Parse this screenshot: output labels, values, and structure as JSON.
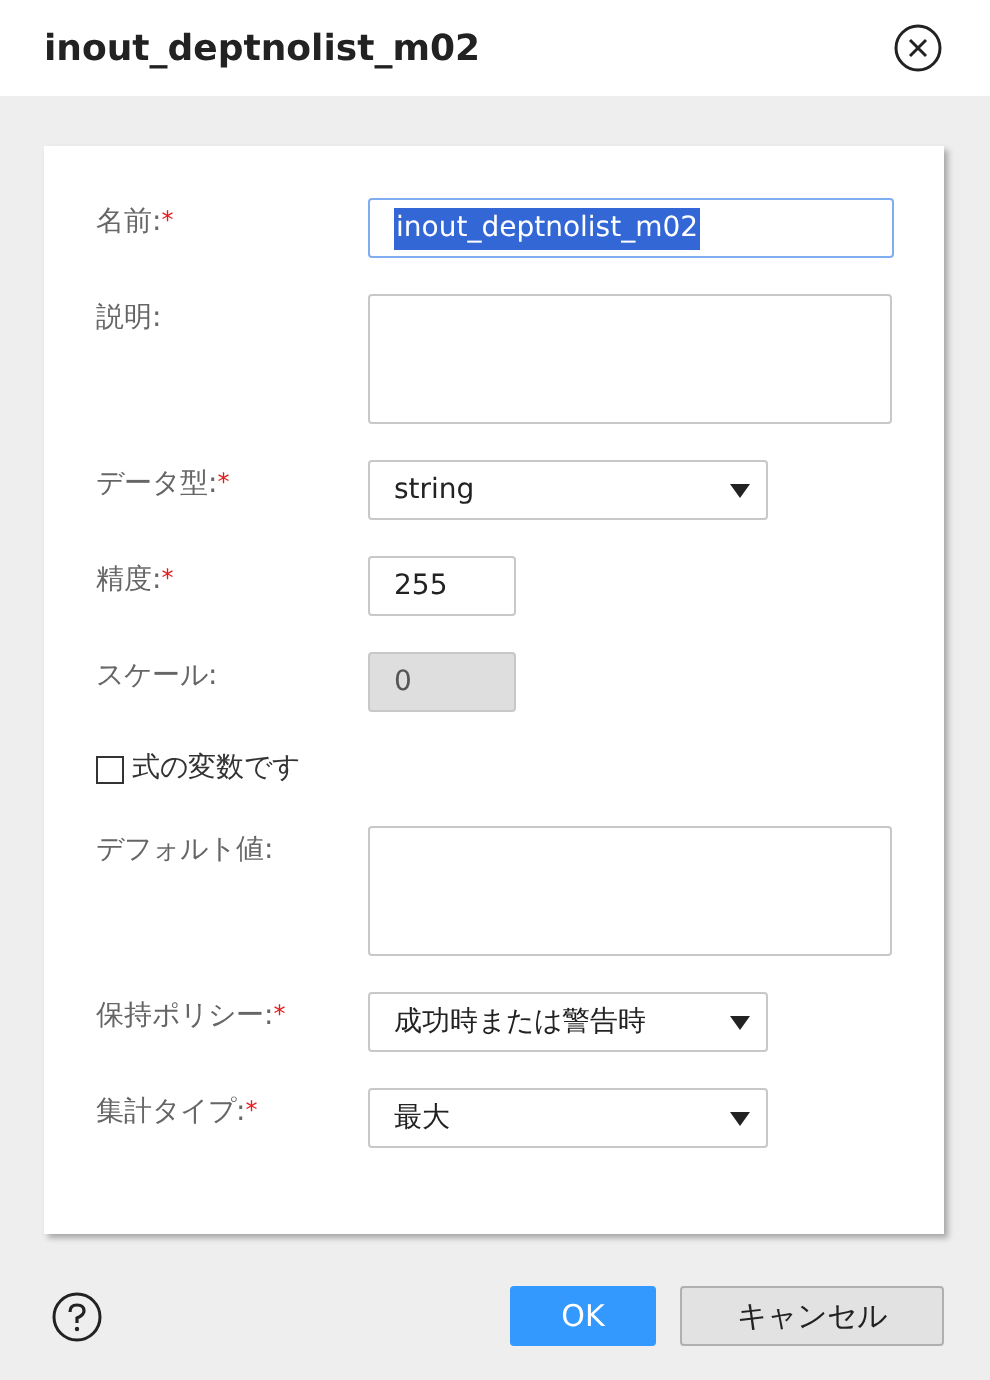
{
  "dialog": {
    "title": "inout_deptnolist_m02"
  },
  "fields": [
    {
      "kind": "text",
      "label": "名前:",
      "required_mark": "*",
      "value": "inout_deptnolist_m02",
      "text_selected": true,
      "disabled": false
    },
    {
      "kind": "textarea",
      "label": "説明:"
    },
    {
      "kind": "select",
      "label": "データ型:",
      "required_mark": "*",
      "value": "string"
    },
    {
      "kind": "number",
      "label": "精度:",
      "required_mark": "*",
      "value": "255",
      "text_selected": false,
      "disabled": false
    },
    {
      "kind": "number",
      "label": "スケール:",
      "value": "0",
      "text_selected": false,
      "disabled": true
    },
    {
      "kind": "checkbox",
      "label": "式の変数です",
      "checked": false
    },
    {
      "kind": "textarea",
      "label": "デフォルト値:"
    },
    {
      "kind": "select",
      "label": "保持ポリシー:",
      "required_mark": "*",
      "value": "成功時または警告時"
    },
    {
      "kind": "select",
      "label": "集計タイプ:",
      "required_mark": "*",
      "value": "最大"
    }
  ],
  "buttons": [
    {
      "label": "OK",
      "kind": "primary"
    },
    {
      "label": "キャンセル",
      "kind": "secondary"
    }
  ]
}
